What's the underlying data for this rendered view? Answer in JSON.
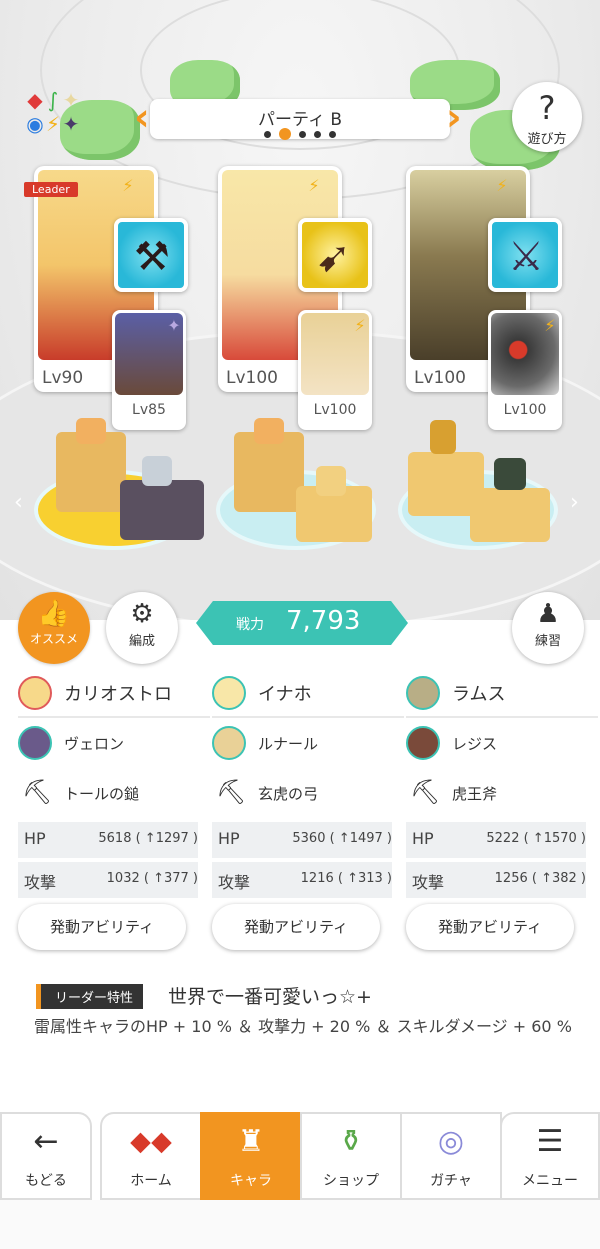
{
  "header": {
    "party_title": "パーティ B",
    "page_count": 5,
    "current_page": 2,
    "help_label": "遊び方",
    "leader_badge": "Leader"
  },
  "cards": [
    {
      "main_level": "Lv90",
      "sub_level": "Lv85",
      "main_colors": [
        "#f7d98a",
        "#c83c2a"
      ],
      "weapon_bg": "#29b8d8",
      "sub_colors": [
        "#5a5fa6",
        "#6a4a3a"
      ]
    },
    {
      "main_level": "Lv100",
      "sub_level": "Lv100",
      "main_colors": [
        "#f8e7a8",
        "#d84a3a"
      ],
      "weapon_bg": "#e8c218",
      "sub_colors": [
        "#e9d197",
        "#f3e3c4"
      ]
    },
    {
      "main_level": "Lv100",
      "sub_level": "Lv100",
      "main_colors": [
        "#d8cfa0",
        "#4a3f2a"
      ],
      "weapon_bg": "#29b8d8",
      "sub_colors": [
        "#6a6a6a",
        "#d83a2a"
      ]
    }
  ],
  "actions": {
    "recommend_label": "オススメ",
    "formation_label": "編成",
    "training_label": "練習",
    "power_label": "戦力",
    "power_value": "7,793"
  },
  "columns": [
    {
      "main_name": "カリオストロ",
      "sub_name": "ヴェロン",
      "weapon_name": "トールの鎚",
      "hp_label": "HP",
      "hp_value": "5618 ( ↑1297 )",
      "atk_label": "攻撃",
      "atk_value": "1032 ( ↑377 )",
      "ability_label": "発動アビリティ",
      "ring_color": "#e05a5a"
    },
    {
      "main_name": "イナホ",
      "sub_name": "ルナール",
      "weapon_name": "玄虎の弓",
      "hp_label": "HP",
      "hp_value": "5360 ( ↑1497 )",
      "atk_label": "攻撃",
      "atk_value": "1216 ( ↑313 )",
      "ability_label": "発動アビリティ",
      "ring_color": "#3cc3b4"
    },
    {
      "main_name": "ラムス",
      "sub_name": "レジス",
      "weapon_name": "虎王斧",
      "hp_label": "HP",
      "hp_value": "5222 ( ↑1570 )",
      "atk_label": "攻撃",
      "atk_value": "1256 ( ↑382 )",
      "ability_label": "発動アビリティ",
      "ring_color": "#3cc3b4"
    }
  ],
  "leader_skill": {
    "tag": "リーダー特性",
    "name": "世界で一番可愛いっ☆+",
    "description": "雷属性キャラのHP + 10 % ＆ 攻撃力 + 20 % ＆ スキルダメージ + 60 %"
  },
  "nav": {
    "back": "もどる",
    "home": "ホーム",
    "chara": "キャラ",
    "shop": "ショップ",
    "gacha": "ガチャ",
    "menu": "メニュー"
  },
  "icons": {
    "element": [
      "diamond-red",
      "leaf-green",
      "star-white",
      "circle-blue",
      "bolt-yellow",
      "star-dark"
    ],
    "bolt": "lightning-bolt-icon",
    "axe": "axe-icon"
  },
  "colors": {
    "accent": "#f29520",
    "teal": "#3cc3b4",
    "leader_red": "#d83a2a"
  }
}
